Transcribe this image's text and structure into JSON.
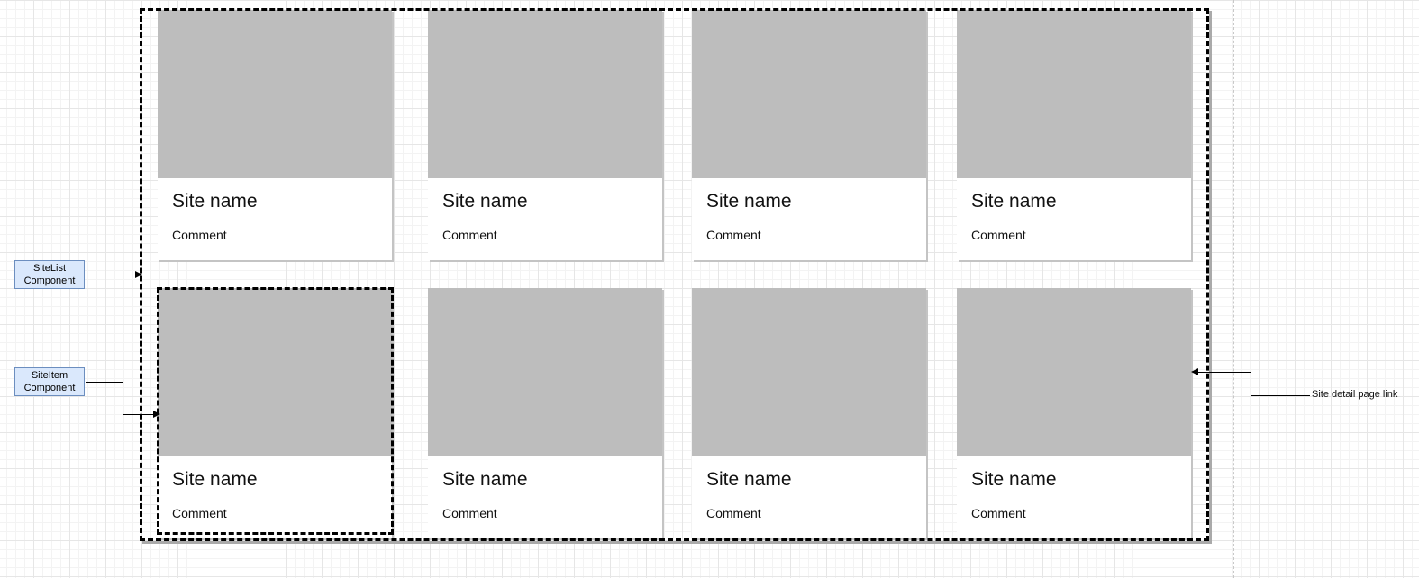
{
  "cards": [
    {
      "name": "Site name",
      "comment": "Comment"
    },
    {
      "name": "Site name",
      "comment": "Comment"
    },
    {
      "name": "Site name",
      "comment": "Comment"
    },
    {
      "name": "Site name",
      "comment": "Comment"
    },
    {
      "name": "Site name",
      "comment": "Comment"
    },
    {
      "name": "Site name",
      "comment": "Comment"
    },
    {
      "name": "Site name",
      "comment": "Comment"
    },
    {
      "name": "Site name",
      "comment": "Comment"
    }
  ],
  "annotations": {
    "sitelist": {
      "line1": "SiteList",
      "line2": "Component"
    },
    "siteitem": {
      "line1": "SiteItem",
      "line2": "Component"
    },
    "detail_link": "Site detail page link"
  },
  "colors": {
    "image_placeholder": "#bdbdbd",
    "label_fill": "#dae8fc",
    "label_border": "#6c8ebf"
  }
}
